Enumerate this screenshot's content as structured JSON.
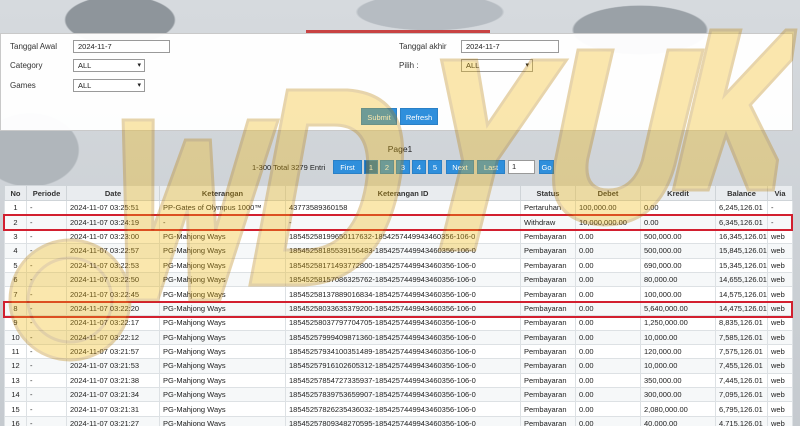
{
  "filters": {
    "tanggal_awal_label": "Tanggal Awal",
    "tanggal_awal_value": "2024-11-7",
    "tanggal_akhir_label": "Tanggal akhir",
    "tanggal_akhir_value": "2024-11-7",
    "category_label": "Category",
    "category_value": "ALL",
    "pilih_label": "Pilih  :",
    "pilih_value": "ALL",
    "games_label": "Games",
    "games_value": "ALL",
    "submit_label": "Submit",
    "refresh_label": "Refresh"
  },
  "pager": {
    "title": "Page1",
    "total_text": "1-300 Total 3279 Entri",
    "first_label": "First",
    "pages": [
      "1",
      "2",
      "3",
      "4",
      "5"
    ],
    "next_label": "Next",
    "last_label": "Last",
    "input_value": "1",
    "go_label": "Go"
  },
  "table": {
    "headers": [
      "No",
      "Periode",
      "Date",
      "Keterangan",
      "Keterangan ID",
      "Status",
      "Debet",
      "Kredit",
      "Balance",
      "Via"
    ],
    "rows": [
      [
        "1",
        "-",
        "2024-11-07 03:25:51",
        "PP-Gates of Olympus 1000™",
        "43773589360158",
        "Pertaruhan",
        "100,000.00",
        "0.00",
        "6,245,126.01",
        "-"
      ],
      [
        "2",
        "-",
        "2024-11-07 03:24:19",
        "-",
        "-",
        "Withdraw",
        "10,000,000.00",
        "0.00",
        "6,345,126.01",
        "-"
      ],
      [
        "3",
        "-",
        "2024-11-07 03:23:00",
        "PG-Mahjong Ways",
        "18545258199650117632-1854257449943460356-106-0",
        "Pembayaran",
        "0.00",
        "500,000.00",
        "16,345,126.01",
        "web"
      ],
      [
        "4",
        "-",
        "2024-11-07 03:22:57",
        "PG-Mahjong Ways",
        "18545258185539156483-1854257449943460356-106-0",
        "Pembayaran",
        "0.00",
        "500,000.00",
        "15,845,126.01",
        "web"
      ],
      [
        "5",
        "-",
        "2024-11-07 03:22:53",
        "PG-Mahjong Ways",
        "18545258171493772800-1854257449943460356-106-0",
        "Pembayaran",
        "0.00",
        "690,000.00",
        "15,345,126.01",
        "web"
      ],
      [
        "6",
        "-",
        "2024-11-07 03:22:50",
        "PG-Mahjong Ways",
        "18545258157086325762-1854257449943460356-106-0",
        "Pembayaran",
        "0.00",
        "80,000.00",
        "14,655,126.01",
        "web"
      ],
      [
        "7",
        "-",
        "2024-11-07 03:22:45",
        "PG-Mahjong Ways",
        "18545258137889016834-1854257449943460356-106-0",
        "Pembayaran",
        "0.00",
        "100,000.00",
        "14,575,126.01",
        "web"
      ],
      [
        "8",
        "-",
        "2024-11-07 03:22:20",
        "PG-Mahjong Ways",
        "18545258033635379200-1854257449943460356-106-0",
        "Pembayaran",
        "0.00",
        "5,640,000.00",
        "14,475,126.01",
        "web"
      ],
      [
        "9",
        "-",
        "2024-11-07 03:22:17",
        "PG-Mahjong Ways",
        "18545258037797704705-1854257449943460356-106-0",
        "Pembayaran",
        "0.00",
        "1,250,000.00",
        "8,835,126.01",
        "web"
      ],
      [
        "10",
        "-",
        "2024-11-07 03:22:12",
        "PG-Mahjong Ways",
        "18545257999409871360-1854257449943460356-106-0",
        "Pembayaran",
        "0.00",
        "10,000.00",
        "7,585,126.01",
        "web"
      ],
      [
        "11",
        "-",
        "2024-11-07 03:21:57",
        "PG-Mahjong Ways",
        "18545257934100351489-1854257449943460356-106-0",
        "Pembayaran",
        "0.00",
        "120,000.00",
        "7,575,126.01",
        "web"
      ],
      [
        "12",
        "-",
        "2024-11-07 03:21:53",
        "PG-Mahjong Ways",
        "18545257916102605312-1854257449943460356-106-0",
        "Pembayaran",
        "0.00",
        "10,000.00",
        "7,455,126.01",
        "web"
      ],
      [
        "13",
        "-",
        "2024-11-07 03:21:38",
        "PG-Mahjong Ways",
        "18545257854727335937-1854257449943460356-106-0",
        "Pembayaran",
        "0.00",
        "350,000.00",
        "7,445,126.01",
        "web"
      ],
      [
        "14",
        "-",
        "2024-11-07 03:21:34",
        "PG-Mahjong Ways",
        "18545257839753659907-1854257449943460356-106-0",
        "Pembayaran",
        "0.00",
        "300,000.00",
        "7,095,126.01",
        "web"
      ],
      [
        "15",
        "-",
        "2024-11-07 03:21:31",
        "PG-Mahjong Ways",
        "18545257826235436032-1854257449943460356-106-0",
        "Pembayaran",
        "0.00",
        "2,080,000.00",
        "6,795,126.01",
        "web"
      ],
      [
        "16",
        "-",
        "2024-11-07 03:21:27",
        "PG-Mahjong Ways",
        "18545257809348270595-1854257449943460356-106-0",
        "Pembayaran",
        "0.00",
        "40,000.00",
        "4,715,126.01",
        "web"
      ]
    ]
  },
  "watermark_text": "WD YUK",
  "colors": {
    "button_blue": "#2f8fdc",
    "link_blue": "#3a8ec9",
    "highlight_red": "#d21f2f",
    "watermark_gold": "#f2b705"
  }
}
